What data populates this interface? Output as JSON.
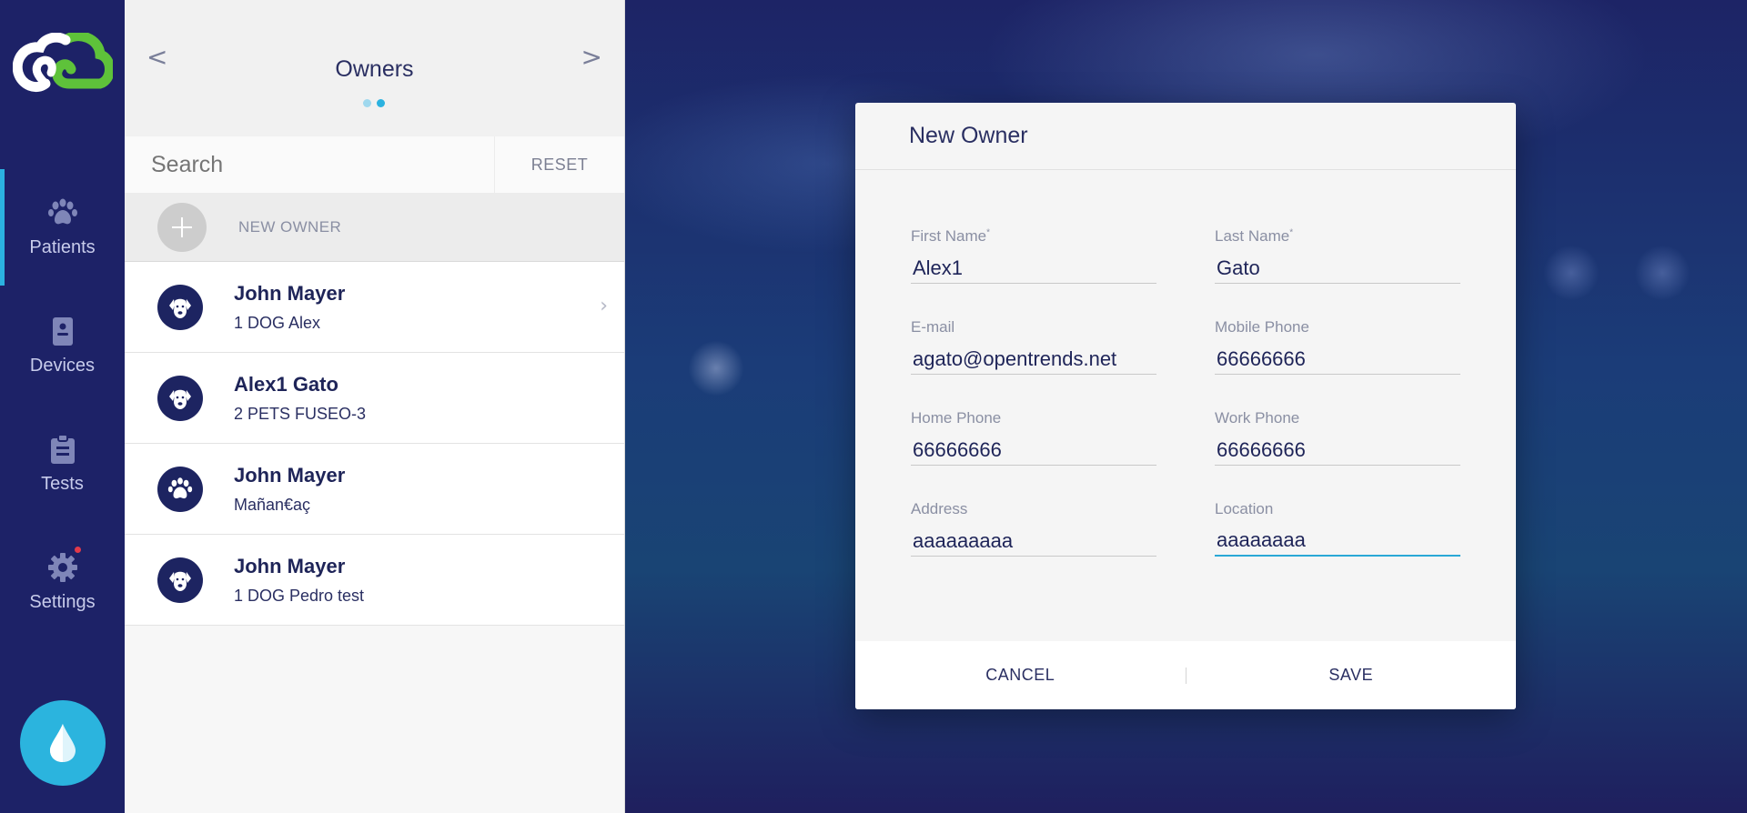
{
  "nav": {
    "items": [
      {
        "label": "Patients",
        "icon": "paw-icon",
        "active": true
      },
      {
        "label": "Devices",
        "icon": "device-icon",
        "active": false
      },
      {
        "label": "Tests",
        "icon": "clipboard-icon",
        "active": false
      },
      {
        "label": "Settings",
        "icon": "gear-icon",
        "active": false,
        "has_notification": true
      }
    ],
    "accent_color": "#2bb2e0",
    "notification_color": "#e23a4a"
  },
  "panel": {
    "title": "Owners",
    "prev_arrow": "<",
    "next_arrow": ">",
    "search_placeholder": "Search",
    "reset_label": "RESET",
    "new_owner_label": "NEW OWNER",
    "owners": [
      {
        "name": "John Mayer",
        "subtitle": "1 DOG Alex",
        "icon": "dog-icon",
        "chevron": "›"
      },
      {
        "name": "Alex1 Gato",
        "subtitle": "2 PETS FUSEO-3",
        "icon": "dog-icon"
      },
      {
        "name": "John Mayer",
        "subtitle": "Mañan€aç",
        "icon": "paw-icon"
      },
      {
        "name": "John Mayer",
        "subtitle": "1 DOG Pedro test",
        "icon": "dog-icon"
      }
    ]
  },
  "modal": {
    "title": "New Owner",
    "fields": {
      "first_name": {
        "label": "First Name",
        "required_mark": "*",
        "value": "Alex1"
      },
      "last_name": {
        "label": "Last Name",
        "required_mark": "*",
        "value": "Gato"
      },
      "email": {
        "label": "E-mail",
        "value": "agato@opentrends.net"
      },
      "mobile_phone": {
        "label": "Mobile Phone",
        "value": "66666666"
      },
      "home_phone": {
        "label": "Home Phone",
        "value": "66666666"
      },
      "work_phone": {
        "label": "Work Phone",
        "value": "66666666"
      },
      "address": {
        "label": "Address",
        "value": "aaaaaaaaa"
      },
      "location": {
        "label": "Location",
        "value": "aaaaaaaa"
      }
    },
    "cancel_label": "CANCEL",
    "save_label": "SAVE"
  }
}
